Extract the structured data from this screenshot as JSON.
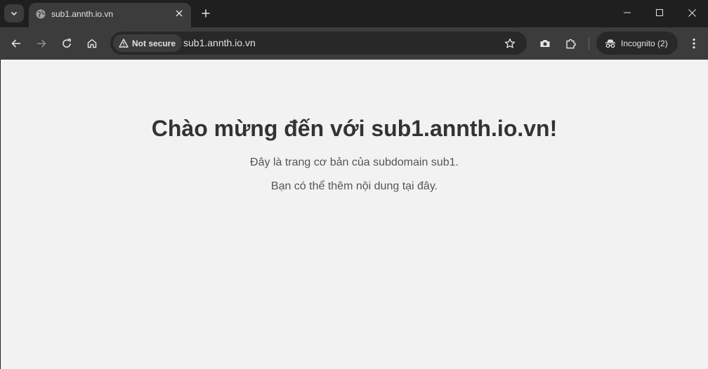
{
  "browser": {
    "tab": {
      "title": "sub1.annth.io.vn",
      "favicon": "globe-icon"
    },
    "window_controls": [
      "minimize-icon",
      "maximize-icon",
      "close-icon"
    ],
    "omnibox": {
      "security_label": "Not secure",
      "url": "sub1.annth.io.vn"
    },
    "incognito": {
      "label": "Incognito (2)"
    }
  },
  "page": {
    "heading": "Chào mừng đến với sub1.annth.io.vn!",
    "line1": "Đây là trang cơ bản của subdomain sub1.",
    "line2": "Bạn có thể thêm nội dung tại đây."
  },
  "colors": {
    "tabstrip": "#1f1f1f",
    "toolbar": "#3c3c3c",
    "page_background": "#f2f2f2",
    "heading": "#333333",
    "body_text": "#555555"
  }
}
